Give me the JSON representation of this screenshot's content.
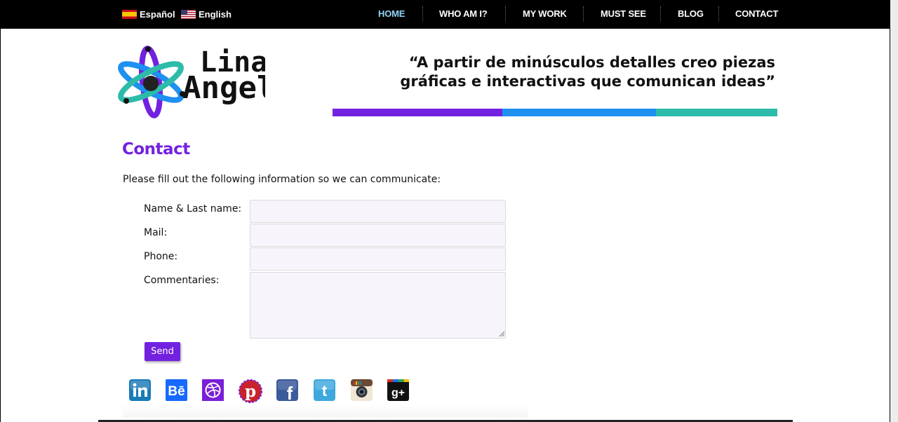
{
  "languages": [
    {
      "label": "Español",
      "flag": "spain-flag-icon"
    },
    {
      "label": "English",
      "flag": "usa-flag-icon"
    }
  ],
  "nav": {
    "items": [
      {
        "label": "HOME",
        "active": true
      },
      {
        "label": "WHO AM I?",
        "active": false
      },
      {
        "label": "MY WORK",
        "active": false
      },
      {
        "label": "MUST SEE",
        "active": false
      },
      {
        "label": "BLOG",
        "active": false
      },
      {
        "label": "CONTACT",
        "active": false
      }
    ],
    "active_color": "#8fd3f4"
  },
  "header": {
    "logo_text": [
      "Lina",
      "Angel"
    ],
    "tagline_lines": [
      "“A partir de minúsculos detalles creo piezas",
      "gráficas e interactivas que comunican ideas”"
    ],
    "bar_colors": [
      "#7321e0",
      "#1e90f0",
      "#2dbbaa"
    ]
  },
  "contact": {
    "title": "Contact",
    "intro": "Please fill out the following information so we can communicate:",
    "fields": [
      {
        "label": "Name & Last name:",
        "value": ""
      },
      {
        "label": "Mail:",
        "value": ""
      },
      {
        "label": "Phone:",
        "value": ""
      },
      {
        "label": "Commentaries:",
        "value": ""
      }
    ],
    "send_label": "Send"
  },
  "social": [
    "linkedin-icon",
    "behance-icon",
    "dribbble-icon",
    "pinterest-icon",
    "facebook-icon",
    "twitter-icon",
    "instagram-icon",
    "google-plus-icon"
  ],
  "colors": {
    "accent": "#7321e0",
    "topbar": "#000000"
  }
}
